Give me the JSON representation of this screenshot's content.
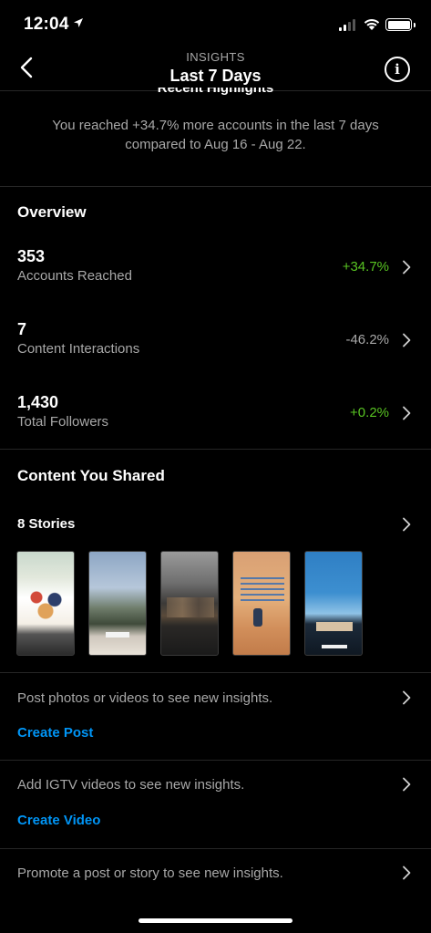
{
  "status_bar": {
    "time": "12:04"
  },
  "header": {
    "subtitle": "INSIGHTS",
    "title": "Last 7 Days",
    "info_glyph": "i"
  },
  "highlights": {
    "title": "Recent Highlights",
    "text": "You reached +34.7% more accounts in the last 7 days compared to Aug 16 - Aug 22."
  },
  "overview": {
    "title": "Overview",
    "metrics": [
      {
        "value": "353",
        "label": "Accounts Reached",
        "change": "+34.7%",
        "trend_color": "#58c322"
      },
      {
        "value": "7",
        "label": "Content Interactions",
        "change": "-46.2%",
        "trend_color": "#a8a8a8"
      },
      {
        "value": "1,430",
        "label": "Total Followers",
        "change": "+0.2%",
        "trend_color": "#58c322"
      }
    ]
  },
  "content_shared": {
    "title": "Content You Shared",
    "stories_label": "8 Stories"
  },
  "prompts": [
    {
      "text": "Post photos or videos to see new insights.",
      "link": "Create Post"
    },
    {
      "text": "Add IGTV videos to see new insights.",
      "link": "Create Video"
    },
    {
      "text": "Promote a post or story to see new insights."
    }
  ],
  "colors": {
    "accent_link": "#0095f6",
    "positive": "#58c322"
  }
}
